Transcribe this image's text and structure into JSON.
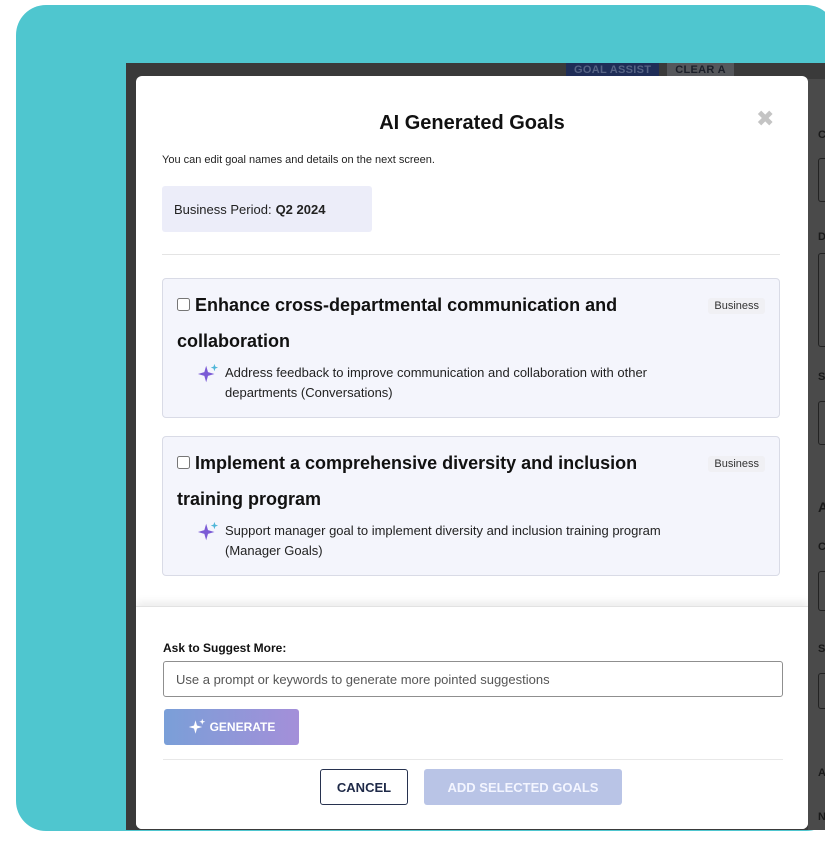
{
  "background": {
    "goal_assist_label": "GOAL ASSIST",
    "clear_label": "CLEAR A",
    "side_letters": [
      "C",
      "D",
      "S",
      "A",
      "C",
      "S",
      "A",
      "N"
    ]
  },
  "modal": {
    "title": "AI Generated Goals",
    "close_icon": "✖",
    "subtitle": "You can edit goal names and details on the next screen.",
    "period_label": "Business Period:",
    "period_value": "Q2 2024",
    "goals": [
      {
        "title": "Enhance cross-departmental communication and collaboration",
        "tag": "Business",
        "description": "Address feedback to improve communication and collaboration with other departments (Conversations)",
        "checked": false
      },
      {
        "title": "Implement a comprehensive diversity and inclusion training program",
        "tag": "Business",
        "description": "Support manager goal to implement diversity and inclusion training program (Manager Goals)",
        "checked": false
      }
    ],
    "ask_label": "Ask to Suggest More:",
    "ask_placeholder": "Use a prompt or keywords to generate more pointed suggestions",
    "generate_label": "GENERATE",
    "cancel_label": "CANCEL",
    "add_label": "ADD SELECTED GOALS"
  },
  "colors": {
    "teal": "#4fc6cf",
    "sparkle": "#7b5bd6",
    "navy": "#1f2a48",
    "disabled_button": "#b9c4e6"
  }
}
